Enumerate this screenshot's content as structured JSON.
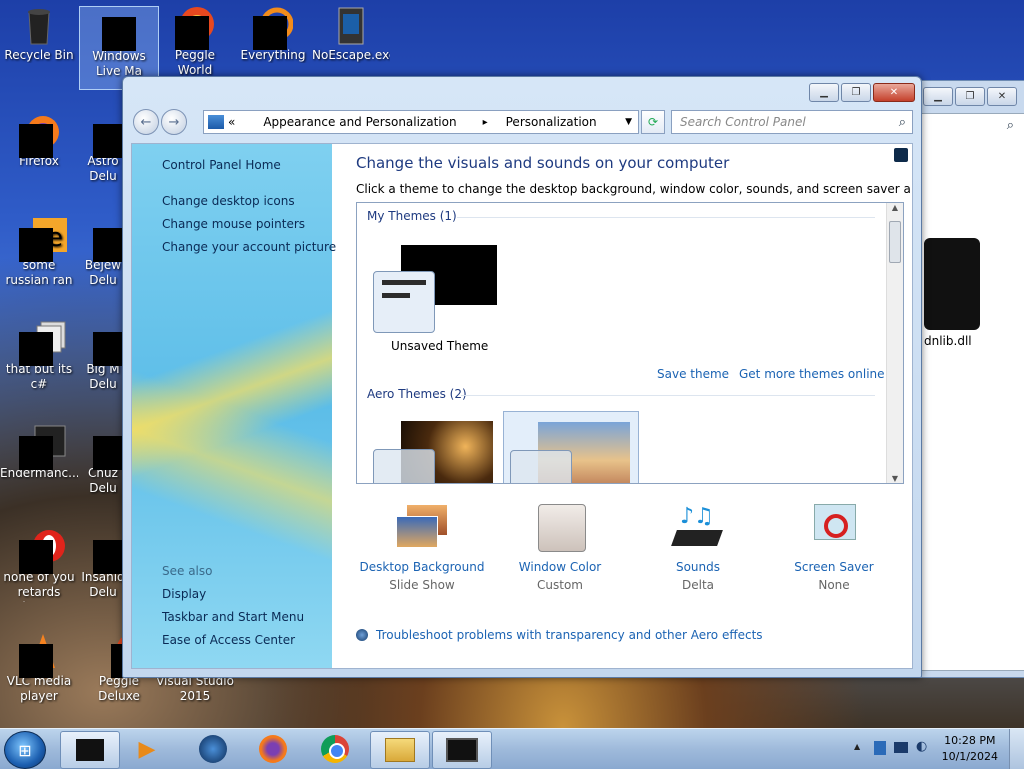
{
  "desktop": {
    "icons": [
      {
        "label": "Recycle Bin"
      },
      {
        "label": "Windows Live Ma"
      },
      {
        "label": "Peggle World"
      },
      {
        "label": "Everything"
      },
      {
        "label": "NoEscape.exe"
      },
      {
        "label": "Firefox"
      },
      {
        "label": "Astro Delu"
      },
      {
        "label": "some russian ran a rat"
      },
      {
        "label": "Bejew Delu"
      },
      {
        "label": "that but its c#"
      },
      {
        "label": "Big M Delu"
      },
      {
        "label": "Endermanc..."
      },
      {
        "label": "Chuz Delu"
      },
      {
        "label": "none of you retards kno..."
      },
      {
        "label": "Insaniq Delu"
      },
      {
        "label": "VLC media player"
      },
      {
        "label": "Peggle Deluxe"
      },
      {
        "label": "Visual Studio 2015"
      },
      {
        "label": "dnlib.dll"
      }
    ]
  },
  "window": {
    "caption_buttons": {
      "minimize": "▁",
      "maximize": "❐",
      "close": "✕"
    },
    "address": {
      "chevron": "«",
      "crumbs": [
        "Appearance and Personalization",
        "Personalization"
      ],
      "sep": "▸"
    },
    "search_placeholder": "Search Control Panel",
    "left_pane": {
      "home": "Control Panel Home",
      "links": [
        "Change desktop icons",
        "Change mouse pointers",
        "Change your account picture"
      ],
      "see_also_title": "See also",
      "see_also": [
        "Display",
        "Taskbar and Start Menu",
        "Ease of Access Center"
      ]
    },
    "main": {
      "title": "Change the visuals and sounds on your computer",
      "subtitle": "Click a theme to change the desktop background, window color, sounds, and screen saver all at once.",
      "my_themes_label": "My Themes (1)",
      "unsaved_theme": "Unsaved Theme",
      "save_theme": "Save theme",
      "get_more": "Get more themes online",
      "aero_label": "Aero Themes (2)",
      "bottom": [
        {
          "label": "Desktop Background",
          "value": "Slide Show"
        },
        {
          "label": "Window Color",
          "value": "Custom"
        },
        {
          "label": "Sounds",
          "value": "Delta"
        },
        {
          "label": "Screen Saver",
          "value": "None"
        }
      ],
      "troubleshoot": "Troubleshoot problems with transparency and other Aero effects"
    }
  },
  "taskbar": {
    "time": "10:28 PM",
    "date": "10/1/2024",
    "tray_arrow": "▲"
  },
  "colors": {
    "link": "#1b63b3",
    "heading": "#1e3a80",
    "accent": "#5cbde8"
  }
}
